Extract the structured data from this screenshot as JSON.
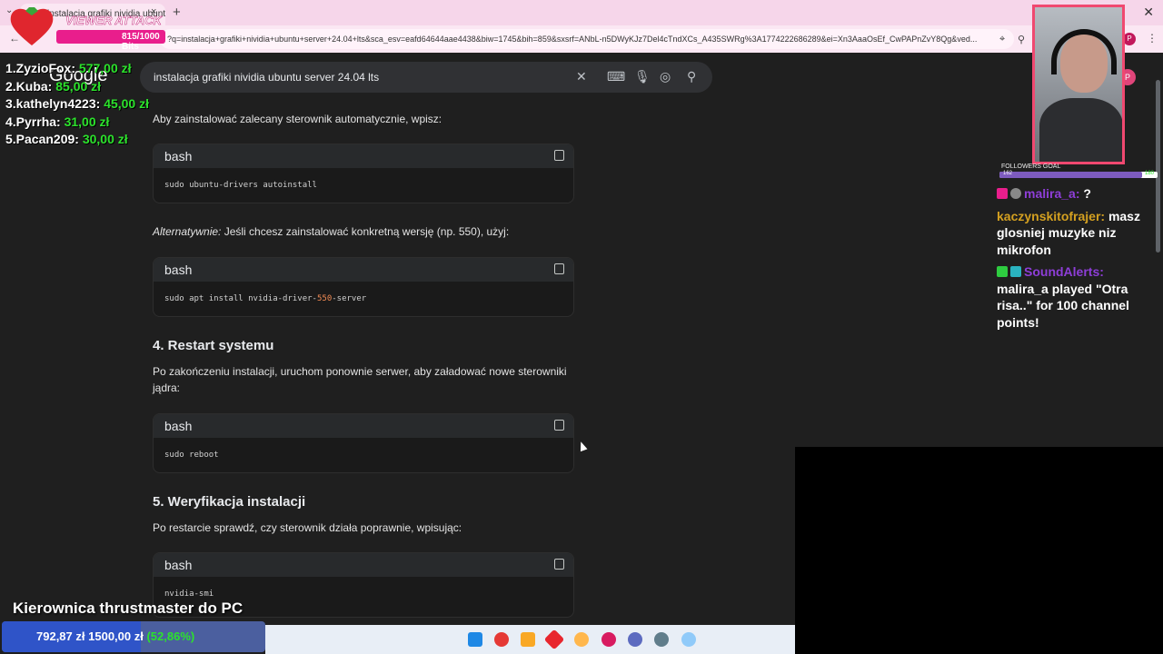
{
  "browser": {
    "tab_title": "instalacja grafiki nividia ubunt",
    "tab_close": "×",
    "new_tab": "+",
    "window_close": "✕",
    "url": "?q=instalacja+grafiki+nividia+ubuntu+server+24.04+lts&sca_esv=eafd64644aae4438&biw=1745&bih=859&sxsrf=ANbL-n5DWyKJz7Del4cTndXCs_A435SWRg%3A1774222686289&ei=Xn3AaaOsEf_CwPAPnZvY8Qg&ved..."
  },
  "search": {
    "logo": "Google",
    "query": "instalacja grafiki nividia ubuntu server 24.04 lts"
  },
  "content": {
    "p1": "Aby zainstalować zalecany sterownik automatycznie, wpisz:",
    "code1": {
      "lang": "bash",
      "cmd": "sudo ubuntu-drivers autoinstall"
    },
    "p2_em": "Alternatywnie:",
    "p2_rest": " Jeśli chcesz zainstalować konkretną wersję (np. 550), użyj:",
    "code2": {
      "lang": "bash",
      "cmd_pre": "sudo apt install nvidia-driver-",
      "cmd_num": "550",
      "cmd_post": "-server"
    },
    "h4": "4. Restart systemu",
    "p3": "Po zakończeniu instalacji, uruchom ponownie serwer, aby załadować nowe sterowniki jądra:",
    "code3": {
      "lang": "bash",
      "cmd": "sudo reboot"
    },
    "h5": "5. Weryfikacja instalacji",
    "p4": "Po restarcie sprawdź, czy sterownik działa poprawnie, wpisując:",
    "code4": {
      "lang": "bash",
      "cmd": "nvidia-smi"
    }
  },
  "overlay": {
    "viewer_attack": {
      "title": "VIEWER ATTACK",
      "bits": "815/1000 Bits"
    },
    "leaderboard": [
      {
        "name": "1.ZyzioFox:",
        "amount": "577,00 zł"
      },
      {
        "name": "2.Kuba:",
        "amount": "85,00 zł"
      },
      {
        "name": "3.kathelyn4223:",
        "amount": "45,00 zł"
      },
      {
        "name": "4.Pyrrha:",
        "amount": "31,00 zł"
      },
      {
        "name": "5.Pacan209:",
        "amount": "30,00 zł"
      }
    ],
    "followers_goal": {
      "label": "FOLLOWERS GOAL",
      "current": "162",
      "max": "180",
      "progress": 0.9
    },
    "chat": [
      {
        "user": "malira_a:",
        "text": " ?"
      },
      {
        "user": "kaczynskitofrajer:",
        "text": " masz glosniej muzyke niz mikrofon"
      },
      {
        "user": "SoundAlerts:",
        "text": " malira_a played \"Otra risa..\" for 100 channel points!"
      }
    ],
    "goal_title": "Kierownica thrustmaster do PC",
    "donation": {
      "current": "792,87 zł",
      "target": "1500,00 zł",
      "percent": "(52,86%)",
      "progress": 0.5286
    }
  }
}
